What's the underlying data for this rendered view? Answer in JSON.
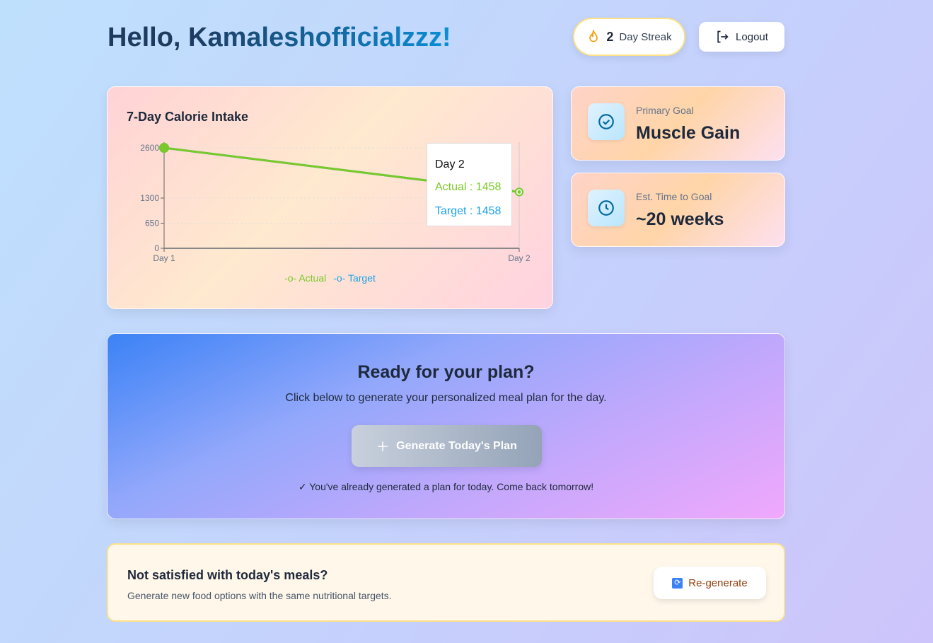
{
  "header": {
    "greeting": "Hello, ",
    "username": "Kamaleshofficialzzz!",
    "streak_count": "2",
    "streak_label": "Day Streak",
    "logout_label": "Logout"
  },
  "chart_data": {
    "type": "line",
    "title": "7-Day Calorie Intake",
    "categories": [
      "Day 1",
      "Day 2"
    ],
    "series": [
      {
        "name": "Actual",
        "values": [
          2600,
          1458
        ],
        "color": "#7ac92a"
      },
      {
        "name": "Target",
        "values": [
          2600,
          1458
        ],
        "color": "#1aa3e8"
      }
    ],
    "yticks": [
      "0",
      "650",
      "1300",
      "2600"
    ],
    "ylim": [
      0,
      2600
    ],
    "legend": "bottom",
    "grid": true,
    "tooltip": {
      "title": "Day 2",
      "actual": "Actual : 1458",
      "target": "Target : 1458"
    }
  },
  "goals": [
    {
      "label": "Primary Goal",
      "value": "Muscle Gain",
      "icon": "check-circle-icon"
    },
    {
      "label": "Est. Time to Goal",
      "value": "~20 weeks",
      "icon": "clock-icon"
    }
  ],
  "plan": {
    "title": "Ready for your plan?",
    "subtitle": "Click below to generate your personalized meal plan for the day.",
    "button": "Generate Today's Plan",
    "note": "✓ You've already generated a plan for today. Come back tomorrow!"
  },
  "regen": {
    "title": "Not satisfied with today's meals?",
    "subtitle": "Generate new food options with the same nutritional targets.",
    "button": "Re-generate"
  }
}
